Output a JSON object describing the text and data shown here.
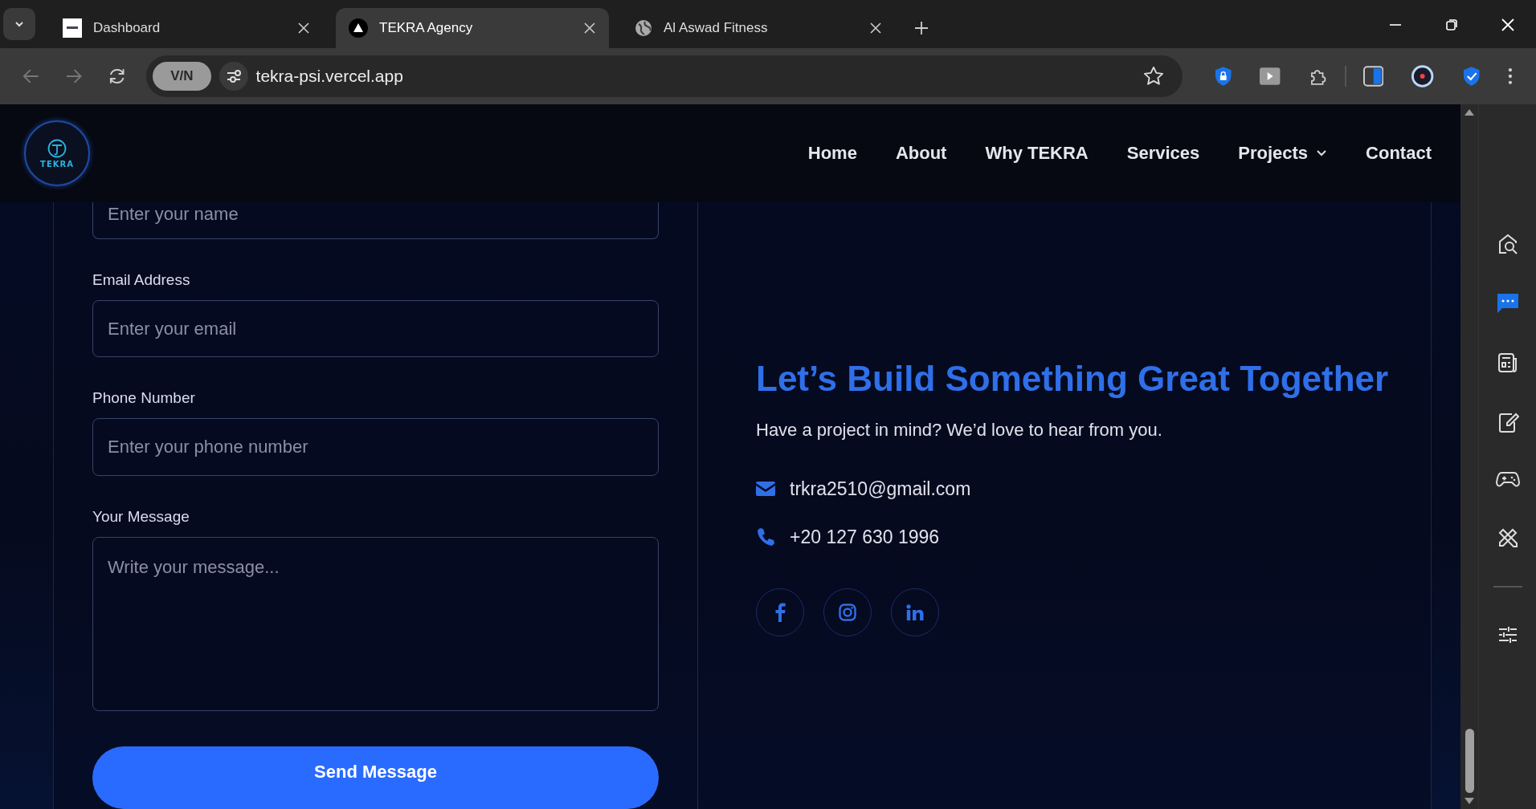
{
  "browser": {
    "tabs": [
      {
        "title": "Dashboard",
        "selected": false,
        "kind": "square"
      },
      {
        "title": "TEKRA Agency",
        "selected": true,
        "kind": "triangle"
      },
      {
        "title": "Al Aswad Fitness",
        "selected": false,
        "kind": "globe"
      }
    ],
    "vpn": "V/N",
    "url": "tekra-psi.vercel.app"
  },
  "site": {
    "logo": "TEKRA",
    "nav": [
      {
        "label": "Home",
        "kind": "link"
      },
      {
        "label": "About",
        "kind": "link"
      },
      {
        "label": "Why TEKRA",
        "kind": "link"
      },
      {
        "label": "Services",
        "kind": "link"
      },
      {
        "label": "Projects",
        "kind": "dropdown"
      },
      {
        "label": "Contact",
        "kind": "link"
      }
    ]
  },
  "form": {
    "fields": [
      {
        "placeholder": "Enter your name",
        "kind": "cut"
      },
      {
        "label": "Email Address",
        "placeholder": "Enter your email",
        "kind": "input"
      },
      {
        "label": "Phone Number",
        "placeholder": "Enter your phone number",
        "kind": "input"
      },
      {
        "label": "Your Message",
        "placeholder": "Write your message...",
        "kind": "textarea"
      }
    ],
    "submit": "Send Message"
  },
  "contact": {
    "heading": "Let’s Build Something Great Together",
    "subtitle": "Have a project in mind? We’d love to hear from you.",
    "items": [
      {
        "kind": "email",
        "text": "trkra2510@gmail.com"
      },
      {
        "kind": "phone",
        "text": "+20 127 630 1996"
      }
    ],
    "socials": [
      {
        "kind": "facebook"
      },
      {
        "kind": "instagram"
      },
      {
        "kind": "linkedin"
      }
    ]
  }
}
